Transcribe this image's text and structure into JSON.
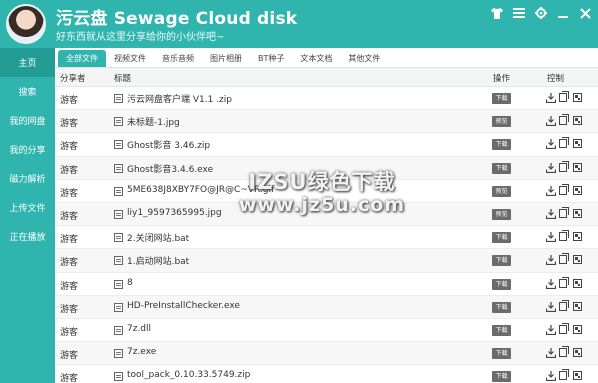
{
  "app": {
    "title": "污云盘 Sewage Cloud disk",
    "subtitle": "好东西就从这里分享给你的小伙伴吧~"
  },
  "window_controls": [
    "shirt-icon",
    "menu-icon",
    "gear-icon",
    "minimize-icon",
    "close-icon"
  ],
  "sidebar": {
    "items": [
      {
        "label": "主页",
        "active": true
      },
      {
        "label": "搜索",
        "active": false
      },
      {
        "label": "我的网盘",
        "active": false
      },
      {
        "label": "我的分享",
        "active": false
      },
      {
        "label": "磁力解析",
        "active": false
      },
      {
        "label": "上传文件",
        "active": false
      },
      {
        "label": "正在播放",
        "active": false
      }
    ]
  },
  "tabs": [
    {
      "label": "全部文件",
      "active": true
    },
    {
      "label": "视频文件",
      "active": false
    },
    {
      "label": "音乐音频",
      "active": false
    },
    {
      "label": "图片相册",
      "active": false
    },
    {
      "label": "BT种子",
      "active": false
    },
    {
      "label": "文本文档",
      "active": false
    },
    {
      "label": "其他文件",
      "active": false
    }
  ],
  "table": {
    "headers": {
      "sharer": "分享者",
      "title": "标题",
      "ops": "操作",
      "ctrl": "控制"
    },
    "rows": [
      {
        "sharer": "游客",
        "name": "污云网盘客户端 V1.1 .zip",
        "action": "下载"
      },
      {
        "sharer": "游客",
        "name": "未标题-1.jpg",
        "action": "预览"
      },
      {
        "sharer": "游客",
        "name": "Ghost影音 3.46.zip",
        "action": "下载"
      },
      {
        "sharer": "游客",
        "name": "Ghost影音3.4.6.exe",
        "action": "下载"
      },
      {
        "sharer": "游客",
        "name": "5ME638J8XBY7FO@JR@C~VR.gif",
        "action": "预览"
      },
      {
        "sharer": "游客",
        "name": "liy1_9597365995.jpg",
        "action": "预览"
      },
      {
        "sharer": "游客",
        "name": "2.关闭网站.bat",
        "action": "下载"
      },
      {
        "sharer": "游客",
        "name": "1.启动网站.bat",
        "action": "下载"
      },
      {
        "sharer": "游客",
        "name": "8",
        "action": "下载"
      },
      {
        "sharer": "游客",
        "name": "HD-PreInstallChecker.exe",
        "action": "下载"
      },
      {
        "sharer": "游客",
        "name": "7z.dll",
        "action": "下载"
      },
      {
        "sharer": "游客",
        "name": "7z.exe",
        "action": "下载"
      },
      {
        "sharer": "游客",
        "name": "tool_pack_0.10.33.5749.zip",
        "action": "下载"
      }
    ]
  },
  "watermark": {
    "line1": "IZSU绿色下载",
    "line2": "www.jz5u.com"
  }
}
